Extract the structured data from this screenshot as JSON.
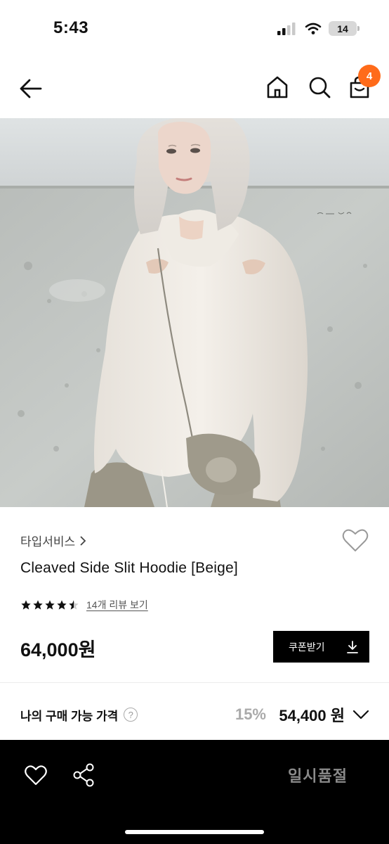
{
  "status_bar": {
    "time": "5:43",
    "battery": "14"
  },
  "header": {
    "back_icon": "arrow-left-icon",
    "home_icon": "home-icon",
    "search_icon": "search-icon",
    "bag_icon": "shopping-bag-icon",
    "bag_badge": "4",
    "badge_color": "#ff6b1a"
  },
  "product": {
    "brand": "타입서비스",
    "title": "Cleaved Side Slit Hoodie [Beige]",
    "rating_stars": 4.5,
    "review_link": "14개 리뷰 보기",
    "price": "64,000원",
    "coupon_label": "쿠폰받기"
  },
  "my_price": {
    "label": "나의 구매 가능 가격",
    "help": "?",
    "discount": "15%",
    "final_price": "54,400 원"
  },
  "bottom_bar": {
    "wish_icon": "heart-outline-icon",
    "share_icon": "share-icon",
    "status_label": "일시품절"
  }
}
